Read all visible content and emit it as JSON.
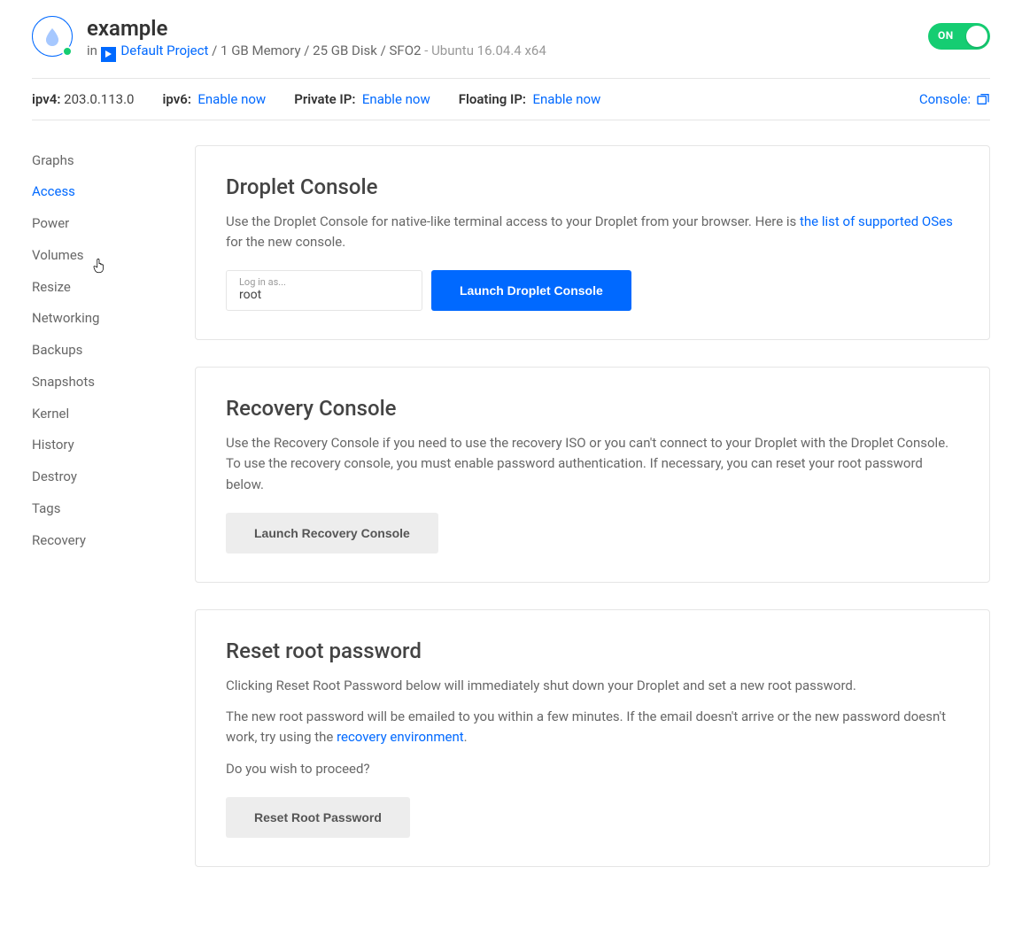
{
  "header": {
    "name": "example",
    "in_label": "in",
    "project": "Default Project",
    "specs": "1 GB Memory / 25 GB Disk / SFO2",
    "os": "Ubuntu 16.04.4 x64",
    "toggle_label": "ON"
  },
  "ipbar": {
    "ipv4_label": "ipv4:",
    "ipv4_value": "203.0.113.0",
    "ipv6_label": "ipv6:",
    "ipv6_link": "Enable now",
    "private_label": "Private IP:",
    "private_link": "Enable now",
    "floating_label": "Floating IP:",
    "floating_link": "Enable now",
    "console_label": "Console:"
  },
  "sidebar": {
    "items": [
      {
        "label": "Graphs",
        "active": false
      },
      {
        "label": "Access",
        "active": true
      },
      {
        "label": "Power",
        "active": false
      },
      {
        "label": "Volumes",
        "active": false
      },
      {
        "label": "Resize",
        "active": false
      },
      {
        "label": "Networking",
        "active": false
      },
      {
        "label": "Backups",
        "active": false
      },
      {
        "label": "Snapshots",
        "active": false
      },
      {
        "label": "Kernel",
        "active": false
      },
      {
        "label": "History",
        "active": false
      },
      {
        "label": "Destroy",
        "active": false
      },
      {
        "label": "Tags",
        "active": false
      },
      {
        "label": "Recovery",
        "active": false
      }
    ]
  },
  "dropletConsole": {
    "title": "Droplet Console",
    "desc_pre": "Use the Droplet Console for native-like terminal access to your Droplet from your browser. Here is ",
    "link": "the list of supported OSes",
    "desc_post": " for the new console.",
    "login_label": "Log in as...",
    "login_value": "root",
    "button": "Launch Droplet Console"
  },
  "recoveryConsole": {
    "title": "Recovery Console",
    "desc": "Use the Recovery Console if you need to use the recovery ISO or you can't connect to your Droplet with the Droplet Console. To use the recovery console, you must enable password authentication. If necessary, you can reset your root password below.",
    "button": "Launch Recovery Console"
  },
  "resetRoot": {
    "title": "Reset root password",
    "p1": "Clicking Reset Root Password below will immediately shut down your Droplet and set a new root password.",
    "p2_pre": "The new root password will be emailed to you within a few minutes. If the email doesn't arrive or the new password doesn't work, try using the ",
    "p2_link": "recovery environment",
    "p2_post": ".",
    "p3": "Do you wish to proceed?",
    "button": "Reset Root Password"
  }
}
